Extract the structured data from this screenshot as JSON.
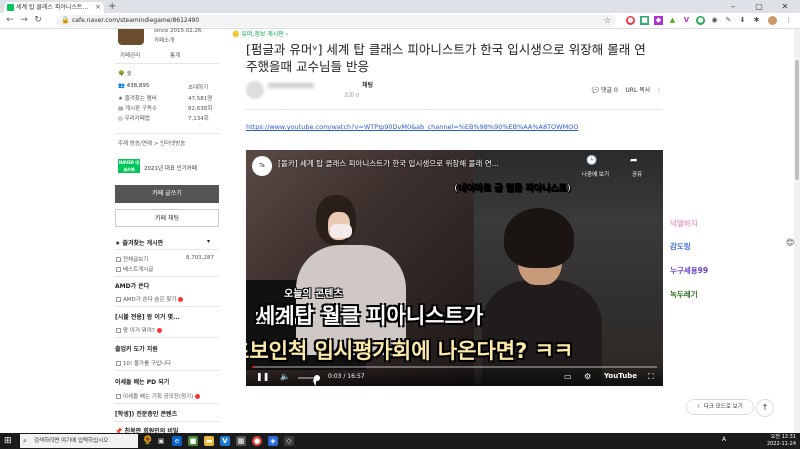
{
  "browser": {
    "tab_title": "세계 탑 클래스 피아니스트...",
    "url": "cafe.naver.com/steamindiegame/8612490"
  },
  "sidebar": {
    "since": "since 2015.02.26.",
    "cafe_intro": "카페소개",
    "manage": "카페관리",
    "stats": "통계",
    "member_grade": "숲",
    "member_count": "438,895",
    "invite": "초대하기",
    "fav_label": "즐겨찾는 멤버",
    "fav_count": "47,581명",
    "board_sub_label": "게시판 구독수",
    "board_sub_count": "82,638회",
    "app_label": "우리카페앱",
    "app_count": "7,134회",
    "theme": "주제 방송/연예 > 인터넷방송",
    "naver_badge": "NAVER 대표카페",
    "award": "2021년 대표 인기카페",
    "write_btn": "카페 글쓰기",
    "chat_btn": "카페 채팅",
    "fav_boards_title": "즐겨찾는 게시판",
    "all_posts": "전체글보기",
    "all_posts_count": "8,703,287",
    "best_board": "베스트게시글",
    "amd_title": "AMD가 쏜다",
    "amd_board": "AMD가 쏜다 숨은 찾기",
    "notice_title": "[시볼 전용] 왕 이거 몇...",
    "notice_board": "왕 이거 뭐야?",
    "guide_title": "출업커 도가 지원",
    "guide_board": "10! 물가를 구입니다",
    "pd_title": "이세돌 배는 PD 되기",
    "pd_board": "이세돌 배는 기획 공모전(정기)",
    "study_title": "[학생]) 전문증인 콘텐츠",
    "bottom_title": "친목판 회원인의 비밀"
  },
  "article": {
    "category": "유머,정보 게시판",
    "title": "[펌글과 유머ᵛ] 세계 탑 클래스 피아니스트가 한국 입시생으로 위장해 몰래 연주했을때 교수님들 반응",
    "author_name": "채팅",
    "views": "조회 0",
    "comments": "댓글 0",
    "url_copy": "URL 복사",
    "youtube_link": "https://www.youtube.com/watch?v=WTPIp90DvM0&ab_channel=%EB%98%90%EB%AA%A8TOWMOO"
  },
  "video": {
    "channel_icon": "Ta",
    "title": "[몰카] 세계 탑 클래스 피아니스트가 한국 입시생으로 위장해 몰래 연...",
    "watch_later": "나중에 보기",
    "share": "공유",
    "caption_small": "(네이마르 급 월클 피아니스트)",
    "caption_1": "오늘의 콘텐츠",
    "caption_2": "세계탑 월클 피아니스트가",
    "caption_3": "초보인척 입시평가회에 나온다면? ㅋㅋ",
    "time": "0:03 / 16:57",
    "progress": 0.003,
    "yt_logo": "YouTube"
  },
  "chat": {
    "names": [
      {
        "text": "넉델하지",
        "color": "#e6a4c8"
      },
      {
        "text": "감도링",
        "color": "#3a6ad9"
      },
      {
        "text": "누구세용99",
        "color": "#6a3fd0"
      },
      {
        "text": "녹두레기",
        "color": "#2a6a1c"
      }
    ],
    "dark_mode": "다크 모드로 보기"
  },
  "taskbar": {
    "search_placeholder": "검색하려면 여기에 입력하십시오.",
    "time": "오전 12:31",
    "date": "2022-11-24",
    "ime": "A"
  }
}
